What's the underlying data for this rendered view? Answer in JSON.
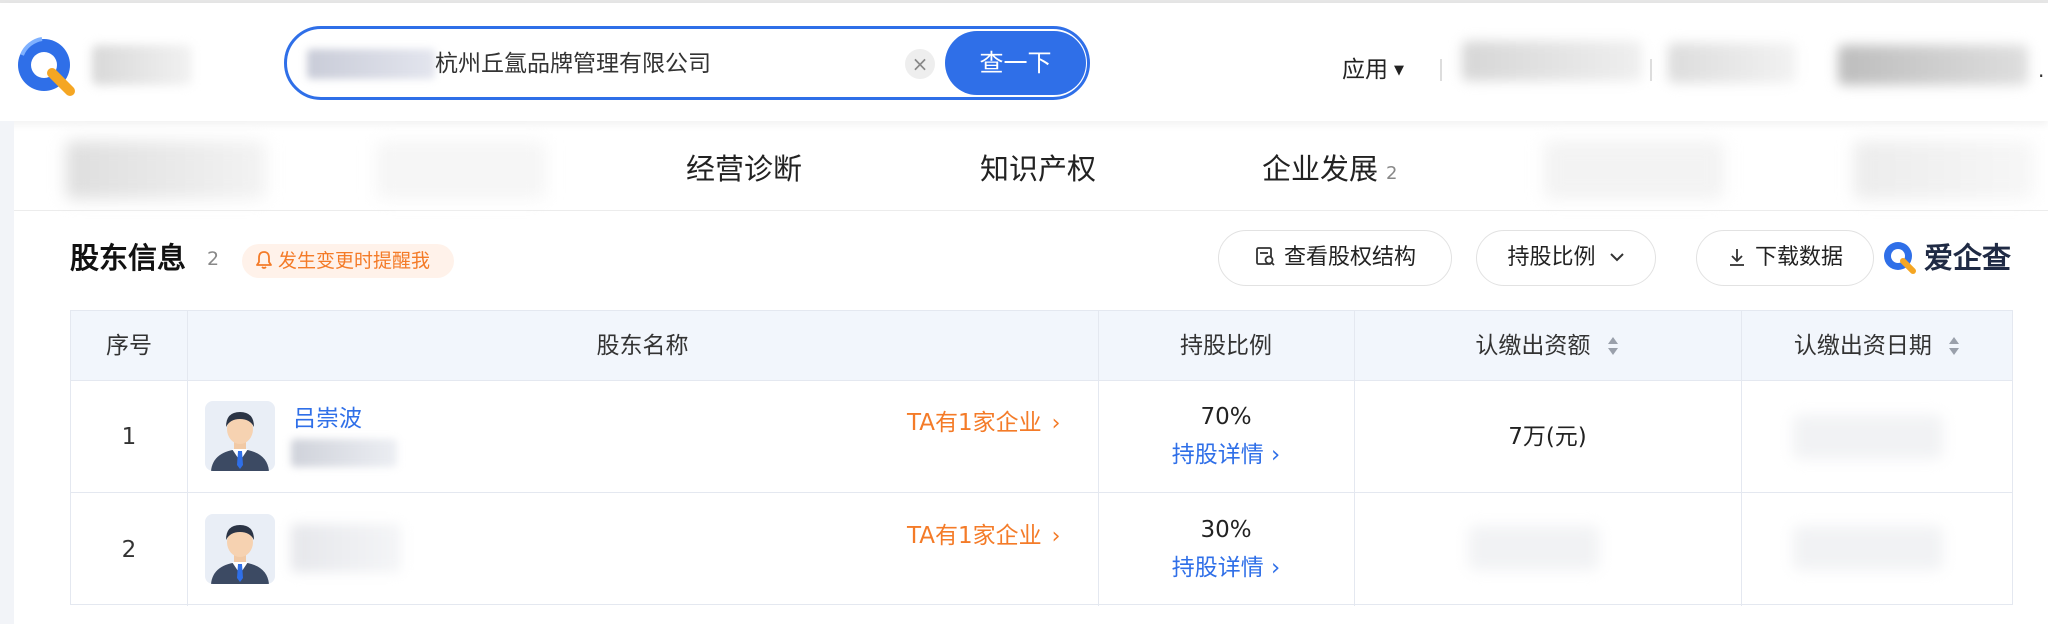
{
  "header": {
    "search_text": "杭州丘氲品牌管理有限公司",
    "clear_label": "×",
    "search_button": "查一下",
    "apps_label": "应用",
    "more_dot": "."
  },
  "nav": {
    "items": [
      {
        "label": "经营诊断",
        "count": ""
      },
      {
        "label": "知识产权",
        "count": ""
      },
      {
        "label": "企业发展",
        "count": "2"
      }
    ]
  },
  "section": {
    "title": "股东信息",
    "count": "2",
    "remind_label": "发生变更时提醒我",
    "btn_structure": "查看股权结构",
    "btn_ratio": "持股比例",
    "btn_download": "下载数据",
    "brand": "爱企查"
  },
  "table": {
    "headers": {
      "index": "序号",
      "name": "股东名称",
      "ratio": "持股比例",
      "amount": "认缴出资额",
      "date": "认缴出资日期"
    },
    "rows": [
      {
        "index": "1",
        "name": "吕崇波",
        "companies": "TA有1家企业",
        "ratio": "70%",
        "detail": "持股详情",
        "amount": "7万(元)"
      },
      {
        "index": "2",
        "name": "",
        "companies": "TA有1家企业",
        "ratio": "30%",
        "detail": "持股详情",
        "amount": ""
      }
    ]
  },
  "colors": {
    "primary": "#2f6fe8",
    "accent_orange": "#f47b28",
    "header_bg": "#f2f6fc"
  }
}
